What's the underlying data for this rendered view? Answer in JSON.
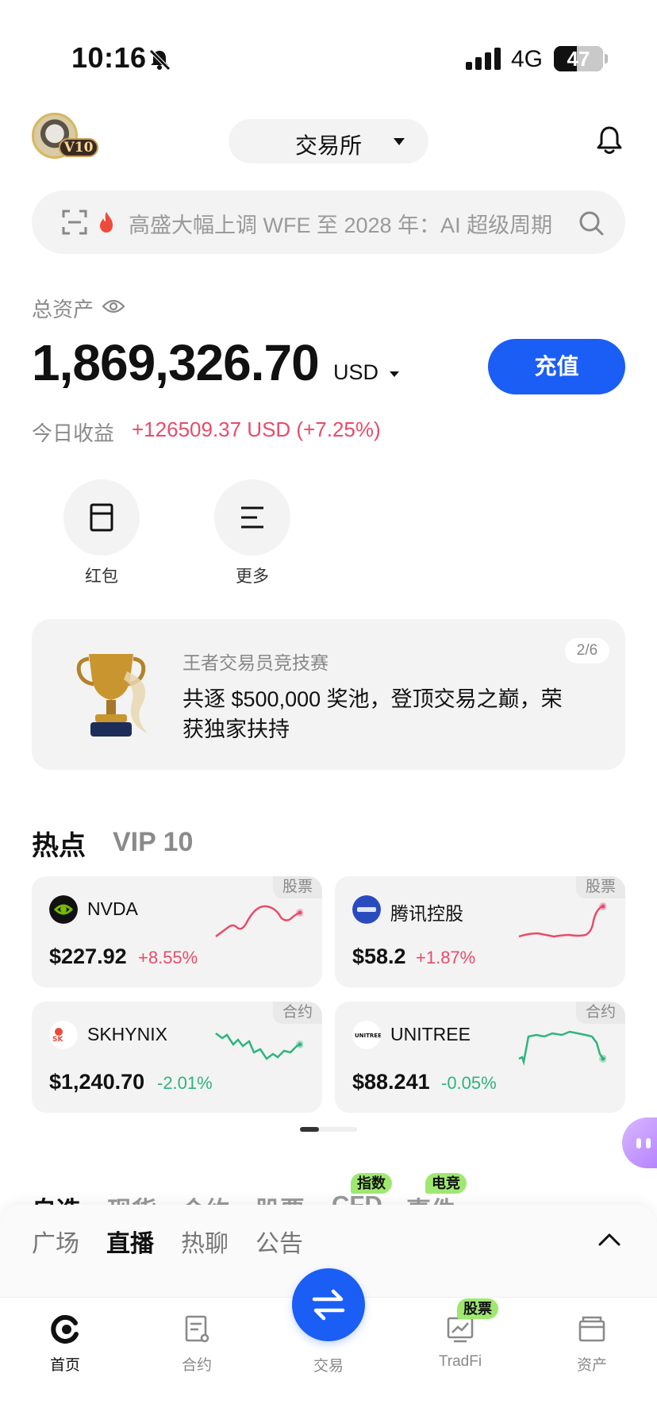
{
  "status_bar": {
    "time": "10:16",
    "network": "4G",
    "battery": "47",
    "battery_level": 0.47
  },
  "header": {
    "vip_level": "V10",
    "exchange_label": "交易所"
  },
  "search": {
    "placeholder": "高盛大幅上调 WFE 至 2028 年：AI 超级周期"
  },
  "assets": {
    "label": "总资产",
    "total": "1,869,326.70",
    "currency": "USD",
    "deposit_label": "充值",
    "pnl_label": "今日收益",
    "pnl_value": "+126509.37 USD (+7.25%)"
  },
  "quick_actions": [
    {
      "label": "红包",
      "icon": "red-packet-icon"
    },
    {
      "label": "更多",
      "icon": "menu-icon"
    }
  ],
  "banner": {
    "subtitle": "王者交易员竞技赛",
    "title": "共逐 $500,000 奖池，登顶交易之巅，荣获独家扶持",
    "page": "2/6"
  },
  "hot": {
    "title": "热点",
    "vip_tab": "VIP 10",
    "cards": [
      {
        "tag": "股票",
        "name": "NVDA",
        "price": "$227.92",
        "change": "+8.55%",
        "direction": "up",
        "color": "#e84b6a"
      },
      {
        "tag": "股票",
        "name": "腾讯控股",
        "price": "$58.2",
        "change": "+1.87%",
        "direction": "up",
        "color": "#e84b6a"
      },
      {
        "tag": "合约",
        "name": "SKHYNIX",
        "price": "$1,240.70",
        "change": "-2.01%",
        "direction": "down",
        "color": "#2eb47d"
      },
      {
        "tag": "合约",
        "name": "UNITREE",
        "price": "$88.241",
        "change": "-0.05%",
        "direction": "down",
        "color": "#2eb47d"
      }
    ]
  },
  "market_tabs": {
    "items": [
      "自选",
      "现货",
      "合约",
      "股票",
      "CFD",
      "事件"
    ],
    "badges": [
      "指数",
      "电竞"
    ]
  },
  "sheet": {
    "tabs": [
      "广场",
      "直播",
      "热聊",
      "公告"
    ],
    "active": "直播"
  },
  "bottom_nav": {
    "items": [
      {
        "label": "首页",
        "icon": "home-icon"
      },
      {
        "label": "合约",
        "icon": "contract-icon"
      },
      {
        "label": "交易",
        "icon": "swap-icon"
      },
      {
        "label": "TradFi",
        "icon": "tradfi-icon"
      },
      {
        "label": "资产",
        "icon": "wallet-icon"
      }
    ],
    "tradfi_badge": "股票"
  },
  "colors": {
    "accent": "#1b5ef5",
    "up": "#e84b6a",
    "down": "#2eb47d",
    "badge": "#9fe870"
  }
}
